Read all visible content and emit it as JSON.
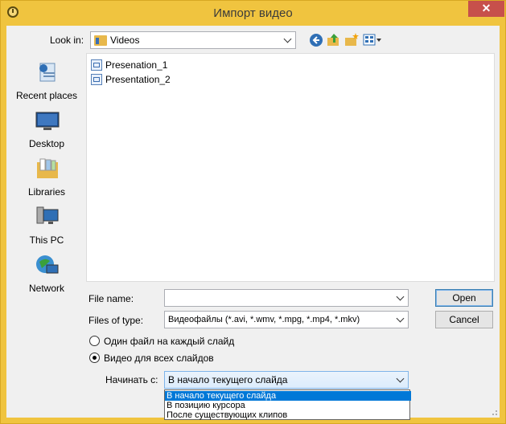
{
  "window": {
    "title": "Импорт видео",
    "close_glyph": "✕"
  },
  "lookin": {
    "label": "Look in:",
    "value": "Videos"
  },
  "toolbar": {
    "icons": [
      "back-icon",
      "up-folder-icon",
      "new-folder-icon",
      "view-menu-icon"
    ]
  },
  "places": [
    {
      "label": "Recent places",
      "icon": "recent-places-icon"
    },
    {
      "label": "Desktop",
      "icon": "desktop-icon"
    },
    {
      "label": "Libraries",
      "icon": "libraries-icon"
    },
    {
      "label": "This PC",
      "icon": "this-pc-icon"
    },
    {
      "label": "Network",
      "icon": "network-icon"
    }
  ],
  "files": [
    {
      "name": "Presenation_1"
    },
    {
      "name": "Presentation_2"
    }
  ],
  "filename": {
    "label": "File name:",
    "value": ""
  },
  "filetype": {
    "label": "Files of type:",
    "value": "Видеофайлы (*.avi, *.wmv, *.mpg, *.mp4, *.mkv)"
  },
  "buttons": {
    "open": "Open",
    "cancel": "Cancel"
  },
  "options": {
    "one_per_slide": "Один файл на каждый слайд",
    "all_slides": "Видео для всех слайдов",
    "selected": "all_slides"
  },
  "start": {
    "label": "Начинать с:",
    "value": "В начало текущего слайда",
    "options": [
      "В начало текущего слайда",
      "В позицию курсора",
      "После существующих клипов"
    ]
  },
  "colors": {
    "titlebar": "#f0c43f",
    "close": "#c7504b",
    "selection": "#0078d7"
  }
}
